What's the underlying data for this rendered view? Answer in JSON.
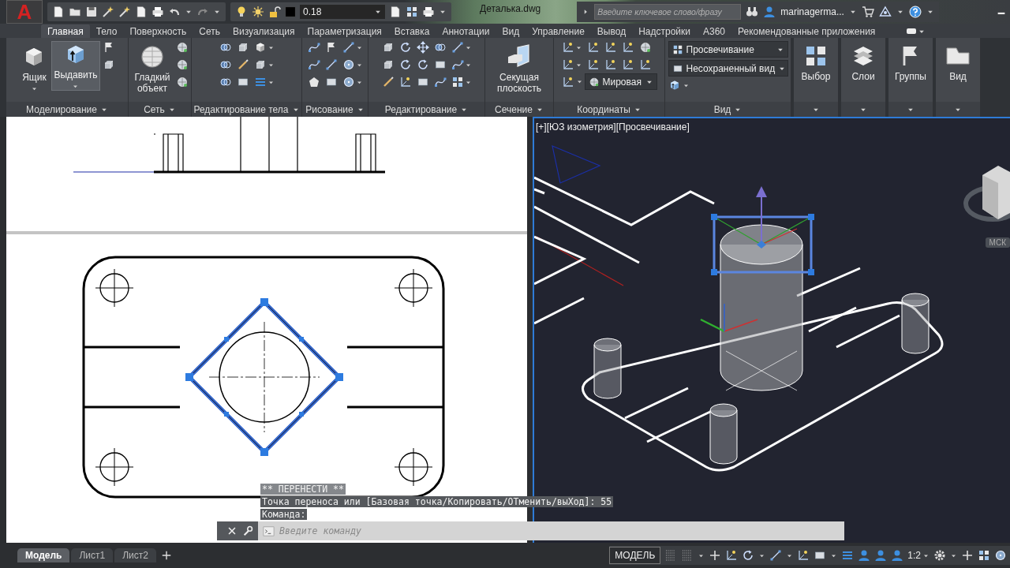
{
  "title_bar": {
    "logo": "A",
    "lineweight": "0.18",
    "filename": "Деталька.dwg",
    "search": {
      "placeholder": "Введите ключевое слово/фразу"
    },
    "user": "marinagerma..."
  },
  "tabs": [
    {
      "label": "Главная",
      "selected": true
    },
    {
      "label": "Тело",
      "selected": false
    },
    {
      "label": "Поверхность",
      "selected": false
    },
    {
      "label": "Сеть",
      "selected": false
    },
    {
      "label": "Визуализация",
      "selected": false
    },
    {
      "label": "Параметризация",
      "selected": false
    },
    {
      "label": "Вставка",
      "selected": false
    },
    {
      "label": "Аннотации",
      "selected": false
    },
    {
      "label": "Вид",
      "selected": false
    },
    {
      "label": "Управление",
      "selected": false
    },
    {
      "label": "Вывод",
      "selected": false
    },
    {
      "label": "Надстройки",
      "selected": false
    },
    {
      "label": "A360",
      "selected": false
    },
    {
      "label": "Рекомендованные приложения",
      "selected": false
    }
  ],
  "ribbon_panels": [
    {
      "label": "Моделирование",
      "big_buttons": [
        {
          "label": "Ящик",
          "highlighted": false
        },
        {
          "label": "Выдавить",
          "highlighted": true
        }
      ]
    },
    {
      "label": "Сеть",
      "big_buttons": [
        {
          "label": "Гладкий объект",
          "highlighted": false
        }
      ]
    },
    {
      "label": "Редактирование тела"
    },
    {
      "label": "Рисование"
    },
    {
      "label": "Редактирование"
    },
    {
      "label": "Сечение",
      "big_buttons": [
        {
          "label": "Секущая плоскость",
          "highlighted": false
        }
      ]
    },
    {
      "label": "Координаты",
      "dropdowns": [
        "Мировая"
      ]
    },
    {
      "label": "Вид",
      "dropdowns": [
        "Просвечивание",
        "Несохраненный вид"
      ]
    },
    {
      "big_buttons": [
        {
          "label": "Выбор",
          "highlighted": false
        }
      ]
    },
    {
      "big_buttons": [
        {
          "label": "Слои",
          "highlighted": false
        }
      ]
    },
    {
      "big_buttons": [
        {
          "label": "Группы",
          "highlighted": false
        }
      ]
    },
    {
      "big_buttons": [
        {
          "label": "Вид",
          "highlighted": false
        }
      ]
    }
  ],
  "viewport": {
    "label": "[+][ЮЗ изометрия][Просвечивание]",
    "ucs_menu": "МСК"
  },
  "command_line": {
    "history": [
      "** ПЕРЕНЕСТИ **",
      "Точка переноса или [Базовая точка/Копировать/ОТменить/выХод]: 55",
      "Команда:"
    ],
    "placeholder": "Введите команду"
  },
  "status_bar": {
    "layout_tabs": [
      {
        "label": "Модель",
        "selected": true
      },
      {
        "label": "Лист1",
        "selected": false
      },
      {
        "label": "Лист2",
        "selected": false
      }
    ],
    "space": "МОДЕЛЬ",
    "scale": "1:2"
  }
}
